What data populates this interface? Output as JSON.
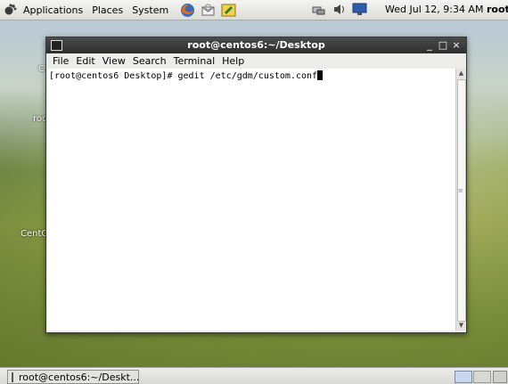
{
  "top_panel": {
    "menus": [
      "Applications",
      "Places",
      "System"
    ],
    "clock": "Wed Jul 12,  9:34 AM",
    "user": "root",
    "launchers": [
      "firefox-icon",
      "mail-icon",
      "notes-icon"
    ],
    "tray": [
      "network-icon",
      "volume-icon",
      "display-icon"
    ]
  },
  "desktop": {
    "labels": [
      "C",
      "roo",
      "CentO"
    ]
  },
  "window": {
    "title": "root@centos6:~/Desktop",
    "controls": {
      "minimize": "_",
      "maximize": "□",
      "close": "×"
    },
    "menu": [
      "File",
      "Edit",
      "View",
      "Search",
      "Terminal",
      "Help"
    ],
    "terminal": {
      "prompt": "[root@centos6 Desktop]# ",
      "command": "gedit /etc/gdm/custom.conf"
    }
  },
  "bottom_panel": {
    "task_label": "root@centos6:~/Deskt..."
  },
  "colors": {
    "titlebar": "#2e2e2e",
    "panel": "#dcdcd8",
    "workspace_active": "#c6d7ef"
  }
}
